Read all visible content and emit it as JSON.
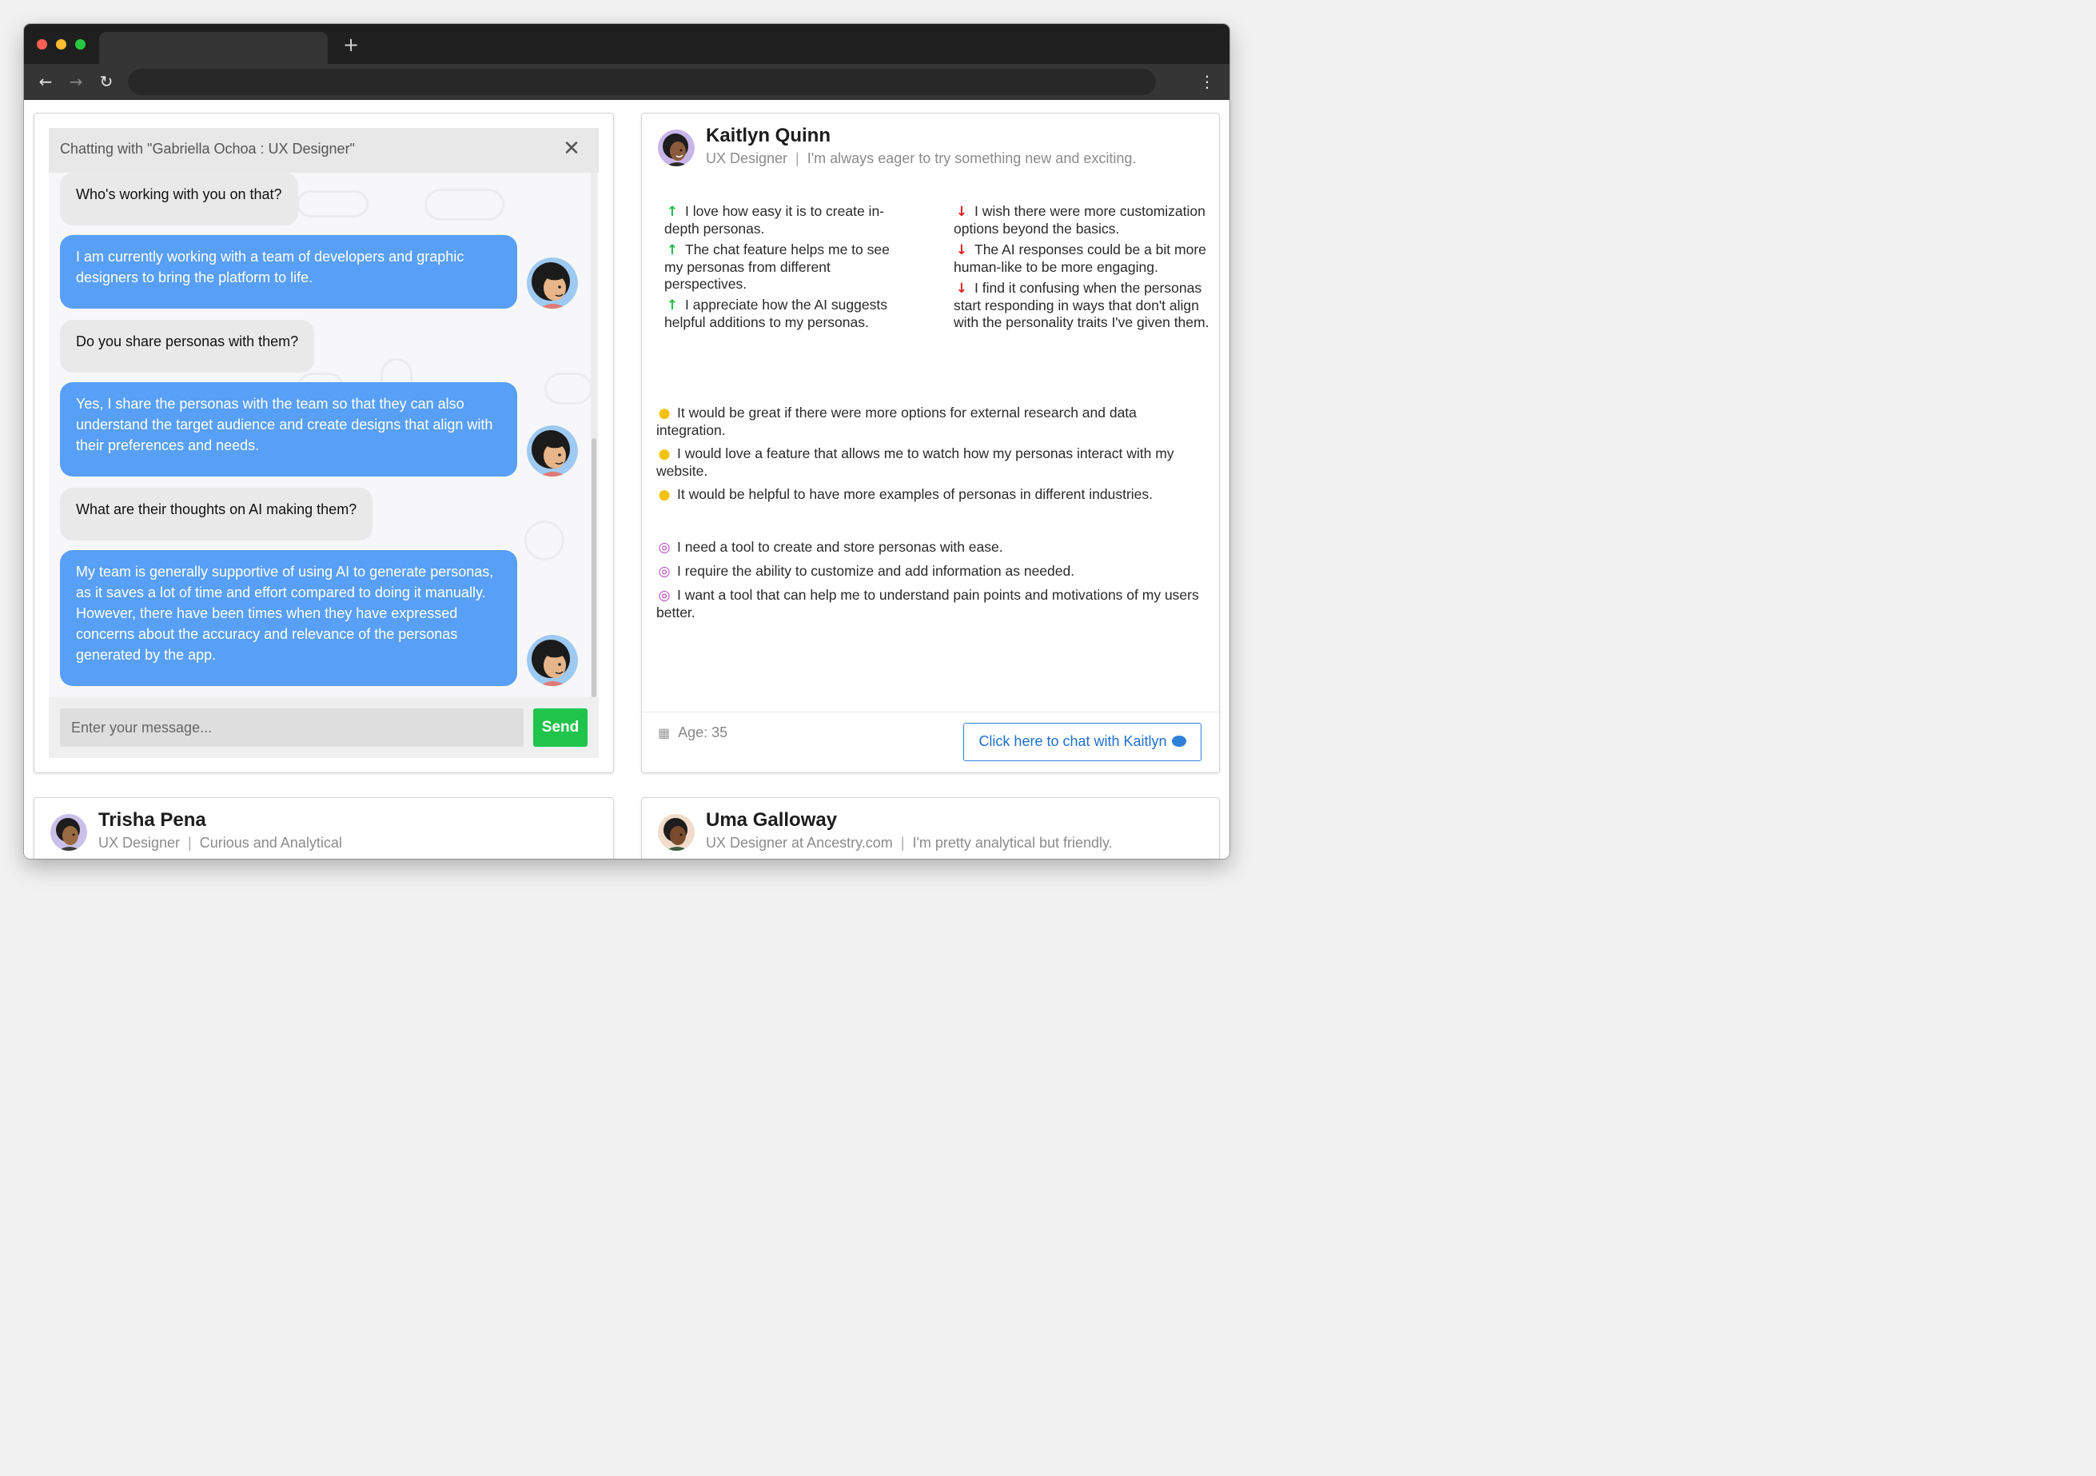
{
  "chat": {
    "title": "Chatting with \"Gabriella Ochoa : UX Designer\"",
    "close_icon": "close-icon",
    "messages": [
      {
        "role": "user",
        "text": "Who's working with you on that?"
      },
      {
        "role": "persona",
        "text": "I am currently working with a team of developers and graphic designers to bring the platform to life."
      },
      {
        "role": "user",
        "text": "Do you share personas with them?"
      },
      {
        "role": "persona",
        "text": "Yes, I share the personas with the team so that they can also understand the target audience and create designs that align with their preferences and needs."
      },
      {
        "role": "user",
        "text": "What are their thoughts on AI making them?"
      },
      {
        "role": "persona",
        "text": "My team is generally supportive of using AI to generate personas, as it saves a lot of time and effort compared to doing it manually. However, there have been times when they have expressed concerns about the accuracy and relevance of the personas generated by the app."
      }
    ],
    "input_placeholder": "Enter your message...",
    "send_label": "Send",
    "colors": {
      "persona_bubble": "#58a0f7",
      "user_bubble": "#e9e9e9",
      "send_button": "#20c44a"
    }
  },
  "persona": {
    "name": "Kaitlyn Quinn",
    "role": "UX Designer",
    "tagline": "I'm always eager to try something new and exciting.",
    "likes": [
      "I love how easy it is to create in-depth personas.",
      "The chat feature helps me to see my personas from different perspectives.",
      "I appreciate how the AI suggests helpful additions to my personas."
    ],
    "dislikes": [
      "I wish there were more customization options beyond the basics.",
      "The AI responses could be a bit more human-like to be more engaging.",
      "I find it confusing when the personas start responding in ways that don't align with the personality traits I've given them."
    ],
    "ideas": [
      "It would be great if there were more options for external research and data integration.",
      "I would love a feature that allows me to watch how my personas interact with my website.",
      "It would be helpful to have more examples of personas in different industries."
    ],
    "needs": [
      "I need a tool to create and store personas with ease.",
      "I require the ability to customize and add information as needed.",
      "I want a tool that can help me to understand pain points and motivations of my users better."
    ],
    "age_label": "Age: 35",
    "chat_button": "Click here to chat with Kaitlyn",
    "icons": {
      "like": "arrow-up-icon",
      "dislike": "arrow-down-icon",
      "idea": "lightbulb-icon",
      "need": "target-icon",
      "age": "calendar-icon",
      "chat": "chat-bubble-icon"
    }
  },
  "other_personas": [
    {
      "name": "Trisha Pena",
      "role": "UX Designer",
      "tagline": "Curious and Analytical"
    },
    {
      "name": "Uma Galloway",
      "role": "UX Designer at Ancestry.com",
      "tagline": "I'm pretty analytical but friendly."
    }
  ]
}
